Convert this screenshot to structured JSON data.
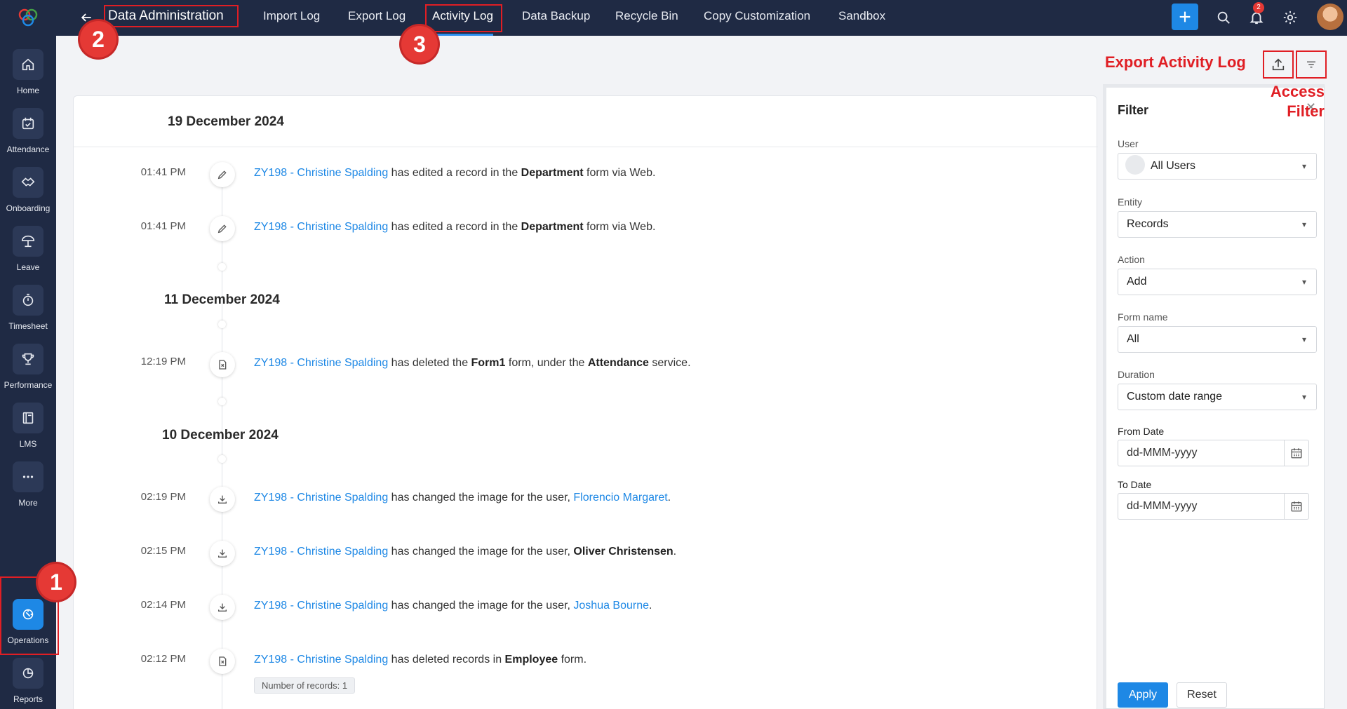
{
  "sidebar": {
    "items": [
      {
        "label": "Home",
        "icon": "home-icon"
      },
      {
        "label": "Attendance",
        "icon": "calendar-check-icon"
      },
      {
        "label": "Onboarding",
        "icon": "handshake-icon"
      },
      {
        "label": "Leave",
        "icon": "beach-umbrella-icon"
      },
      {
        "label": "Timesheet",
        "icon": "stopwatch-icon"
      },
      {
        "label": "Performance",
        "icon": "trophy-icon"
      },
      {
        "label": "LMS",
        "icon": "book-icon"
      },
      {
        "label": "More",
        "icon": "more-dots-icon"
      },
      {
        "label": "Operations",
        "icon": "operations-icon"
      },
      {
        "label": "Reports",
        "icon": "pie-chart-icon"
      }
    ]
  },
  "header": {
    "title": "Data Administration",
    "tabs": [
      "Import Log",
      "Export Log",
      "Activity Log",
      "Data Backup",
      "Recycle Bin",
      "Copy Customization",
      "Sandbox"
    ],
    "active_tab": "Activity Log",
    "notification_count": "2"
  },
  "timeline": {
    "groups": [
      {
        "date": "19 December 2024",
        "entries": [
          {
            "time": "01:41 PM",
            "icon": "pencil-icon",
            "user": "ZY198 - Christine Spalding",
            "text1": " has edited a record in the ",
            "bold1": "Department",
            "text2": " form via Web."
          },
          {
            "time": "01:41 PM",
            "icon": "pencil-icon",
            "user": "ZY198 - Christine Spalding",
            "text1": " has edited a record in the ",
            "bold1": "Department",
            "text2": " form via Web."
          }
        ]
      },
      {
        "date": "11 December 2024",
        "entries": [
          {
            "time": "12:19 PM",
            "icon": "delete-form-icon",
            "user": "ZY198 - Christine Spalding",
            "text1": " has deleted the ",
            "bold1": "Form1",
            "text2": " form, under the ",
            "bold2": "Attendance",
            "text3": " service."
          }
        ]
      },
      {
        "date": "10 December 2024",
        "entries": [
          {
            "time": "02:19 PM",
            "icon": "download-icon",
            "user": "ZY198 - Christine Spalding",
            "text1": " has changed the image for the user, ",
            "link2": "Florencio Margaret",
            "text2": "."
          },
          {
            "time": "02:15 PM",
            "icon": "download-icon",
            "user": "ZY198 - Christine Spalding",
            "text1": " has changed the image for the user, ",
            "bold1": "Oliver Christensen",
            "text2": "."
          },
          {
            "time": "02:14 PM",
            "icon": "download-icon",
            "user": "ZY198 - Christine Spalding",
            "text1": " has changed the image for the user, ",
            "link2": "Joshua Bourne",
            "text2": "."
          },
          {
            "time": "02:12 PM",
            "icon": "delete-form-icon",
            "user": "ZY198 - Christine Spalding",
            "text1": " has deleted records in ",
            "bold1": "Employee",
            "text2": " form.",
            "chip": "Number of records: 1"
          }
        ]
      }
    ]
  },
  "filter": {
    "title": "Filter",
    "user_label": "User",
    "user_value": "All Users",
    "entity_label": "Entity",
    "entity_value": "Records",
    "action_label": "Action",
    "action_value": "Add",
    "form_label": "Form name",
    "form_value": "All",
    "duration_label": "Duration",
    "duration_value": "Custom date range",
    "from_label": "From Date",
    "from_placeholder": "dd-MMM-yyyy",
    "to_label": "To Date",
    "to_placeholder": "dd-MMM-yyyy",
    "apply": "Apply",
    "reset": "Reset"
  },
  "annotations": {
    "export_label": "Export Activity Log",
    "filter_label_1": "Access",
    "filter_label_2": "Filter",
    "num1": "1",
    "num2": "2",
    "num3": "3"
  },
  "colors": {
    "sidebar_bg": "#1f2a44",
    "accent": "#1e88e5",
    "annotation_red": "#e01e24"
  }
}
